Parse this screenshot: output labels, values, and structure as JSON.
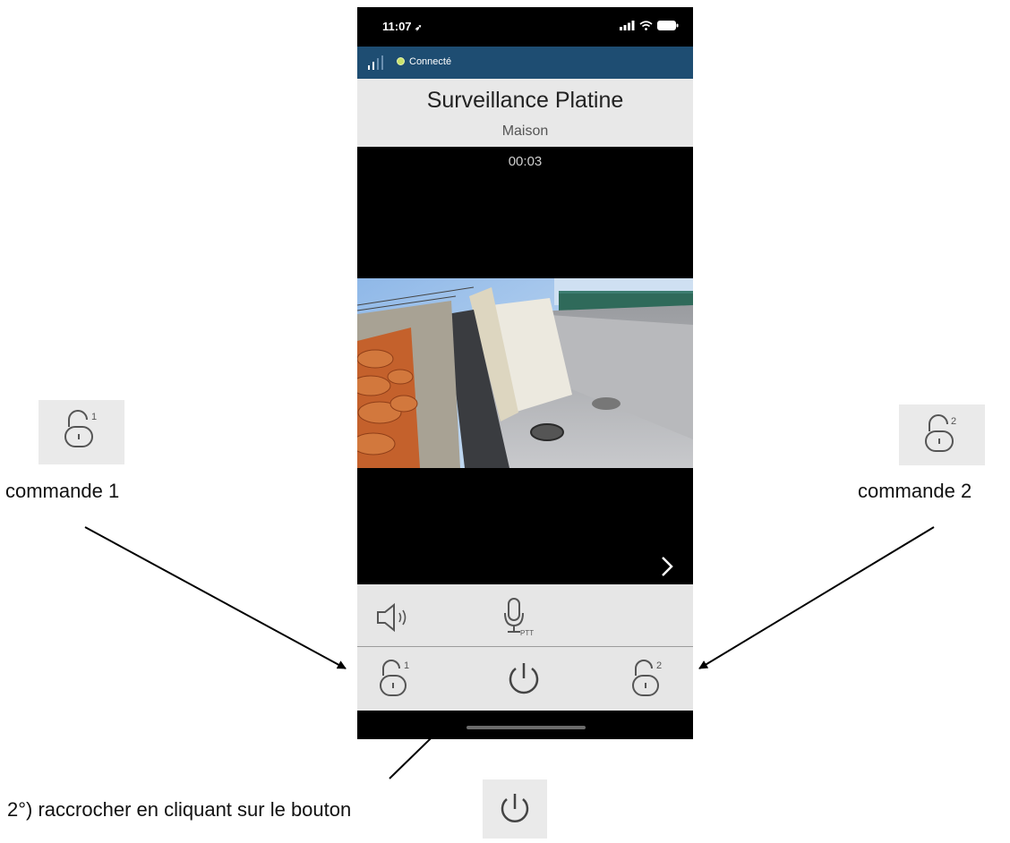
{
  "status_bar": {
    "time": "11:07",
    "location_icon": "location-arrow-icon",
    "signal_icon": "cellular-signal-icon",
    "wifi_icon": "wifi-icon",
    "battery_icon": "battery-icon"
  },
  "connection": {
    "text": "Connecté",
    "status_color": "#c9e26b",
    "bar_color": "#1e4d72"
  },
  "header": {
    "title": "Surveillance Platine",
    "subtitle": "Maison"
  },
  "call": {
    "timer": "00:03"
  },
  "controls": {
    "speaker_icon": "speaker-icon",
    "mic_icon": "microphone-ptt-icon",
    "mic_label": "PTT",
    "command1": {
      "icon": "padlock-open-icon",
      "number": "1"
    },
    "hangup": {
      "icon": "power-icon"
    },
    "command2": {
      "icon": "padlock-open-icon",
      "number": "2"
    }
  },
  "annotations": {
    "command1_label": "commande 1",
    "command2_label": "commande 2",
    "hangup_instruction": "2°) raccrocher en cliquant sur le bouton"
  }
}
